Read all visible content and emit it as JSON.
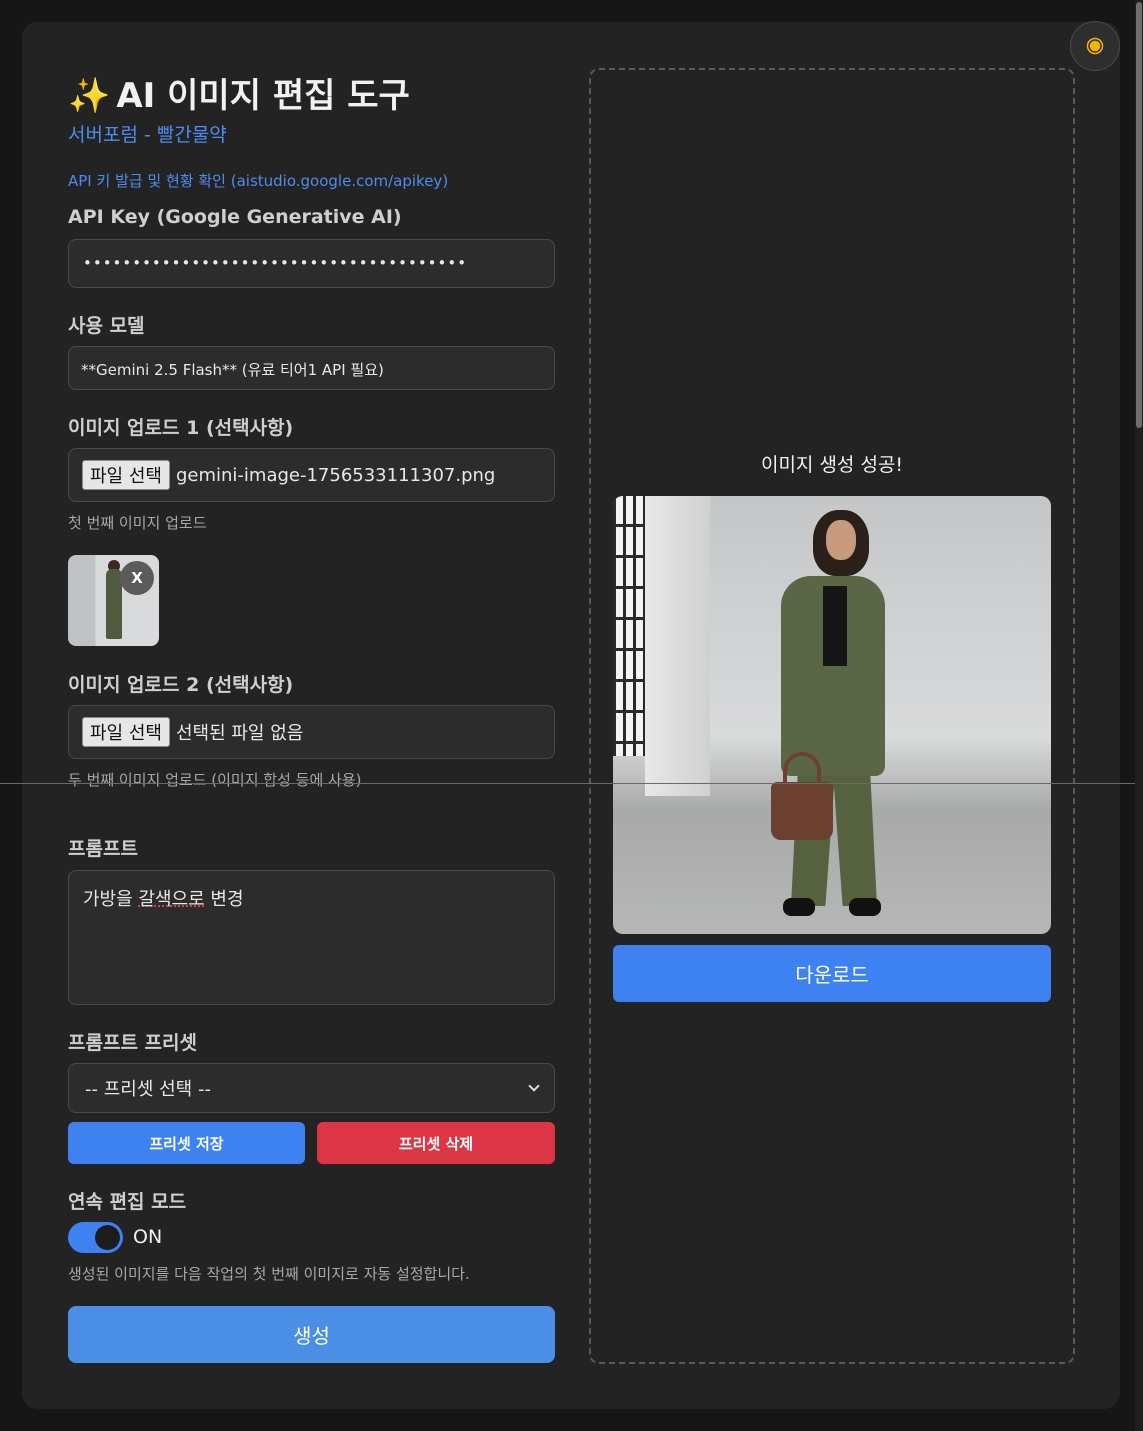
{
  "header": {
    "title_icon": "sparkles-icon",
    "title": "AI 이미지 편집 도구",
    "subtitle": "서버포럼 - 빨간물약",
    "api_link": "API 키 발급 및 현황 확인 (aistudio.google.com/apikey)"
  },
  "theme_toggle": {
    "icon": "sun-icon"
  },
  "api_key": {
    "label": "API Key (Google Generative AI)",
    "value": "•••••••••••••••••••••••••••••••••••••••"
  },
  "model": {
    "label": "사용 모델",
    "selected": "**Gemini 2.5 Flash** (유료 티어1 API 필요)"
  },
  "upload1": {
    "label": "이미지 업로드 1 (선택사항)",
    "button": "파일 선택",
    "filename": "gemini-image-1756533111307.png",
    "hint": "첫 번째 이미지 업로드",
    "remove": "X"
  },
  "upload2": {
    "label": "이미지 업로드 2 (선택사항)",
    "button": "파일 선택",
    "filename": "선택된 파일 없음",
    "hint": "두 번째 이미지 업로드 (이미지 합성 등에 사용)"
  },
  "prompt": {
    "label": "프롬프트",
    "value_parts": [
      "가방을 ",
      "갈색으로",
      " 변경"
    ]
  },
  "presets": {
    "label": "프롬프트 프리셋",
    "selected": "-- 프리셋 선택 --",
    "save": "프리셋 저장",
    "delete": "프리셋 삭제"
  },
  "continuous": {
    "label": "연속 편집 모드",
    "state": "ON",
    "enabled": true,
    "hint": "생성된 이미지를 다음 작업의 첫 번째 이미지로 자동 설정합니다."
  },
  "generate_label": "생성",
  "result": {
    "status": "이미지 생성 성공!",
    "download": "다운로드"
  },
  "colors": {
    "accent": "#3d82f0",
    "danger": "#dc3545",
    "link": "#4c8df0",
    "background": "#232323"
  }
}
